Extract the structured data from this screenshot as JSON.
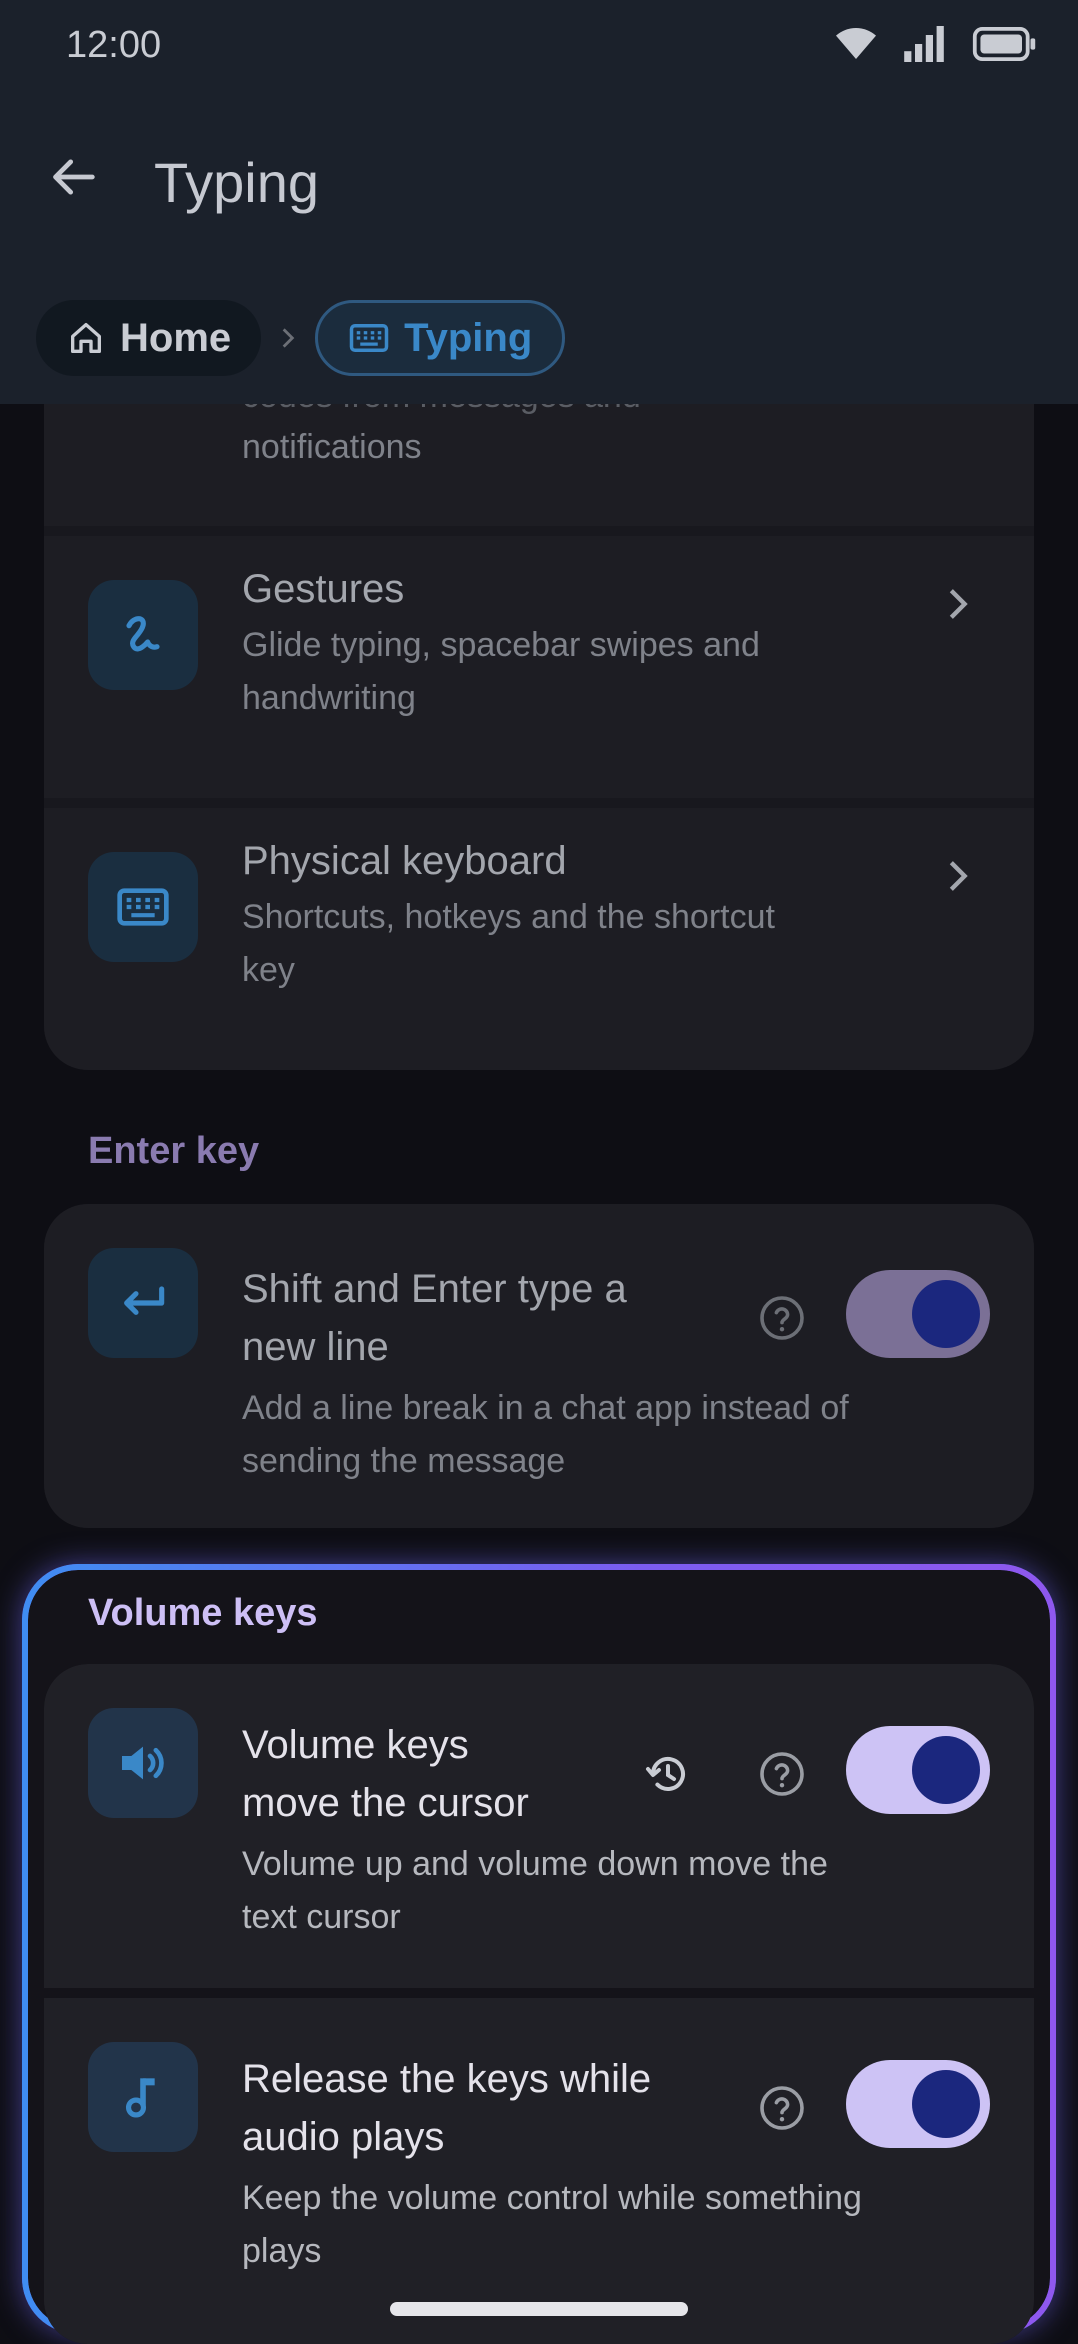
{
  "status": {
    "time": "12:00"
  },
  "header": {
    "title": "Typing"
  },
  "breadcrumb": {
    "home": "Home",
    "current": "Typing"
  },
  "partial_item": {
    "subtitle_line1": "codes from messages and",
    "subtitle_line2": "notifications"
  },
  "items": {
    "gestures": {
      "title": "Gestures",
      "subtitle_line1": "Glide typing, spacebar swipes and",
      "subtitle_line2": "handwriting"
    },
    "physical_keyboard": {
      "title": "Physical keyboard",
      "subtitle_line1": "Shortcuts, hotkeys and the shortcut",
      "subtitle_line2": "key"
    }
  },
  "enter_key": {
    "section": "Enter key",
    "shift_enter": {
      "title_line1": "Shift and Enter type a",
      "title_line2": "new line",
      "subtitle_line1": "Add a line break in a chat app instead of",
      "subtitle_line2": "sending the message",
      "enabled": true
    }
  },
  "volume_keys": {
    "section": "Volume keys",
    "move_cursor": {
      "title_line1": "Volume keys",
      "title_line2": "move the cursor",
      "subtitle_line1": "Volume up and volume down move the",
      "subtitle_line2": "text cursor",
      "enabled": true
    },
    "release_keys": {
      "title_line1": "Release the keys while",
      "title_line2": "audio plays",
      "subtitle_line1": "Keep the volume control while something",
      "subtitle_line2": "plays",
      "enabled": true
    }
  },
  "colors": {
    "accent_blue": "#3a88c8",
    "toggle_on_track": "#cdc3f5",
    "toggle_dim_track": "#7b7096",
    "toggle_knob": "#1b277e",
    "highlight_start": "#3f8df2",
    "highlight_end": "#8f58ef"
  },
  "icons": [
    "wifi-icon",
    "signal-icon",
    "battery-icon",
    "back-arrow-icon",
    "home-icon",
    "keyboard-icon",
    "gesture-icon",
    "enter-key-icon",
    "volume-icon",
    "music-note-icon",
    "history-icon",
    "help-icon",
    "chevron-right-icon"
  ]
}
